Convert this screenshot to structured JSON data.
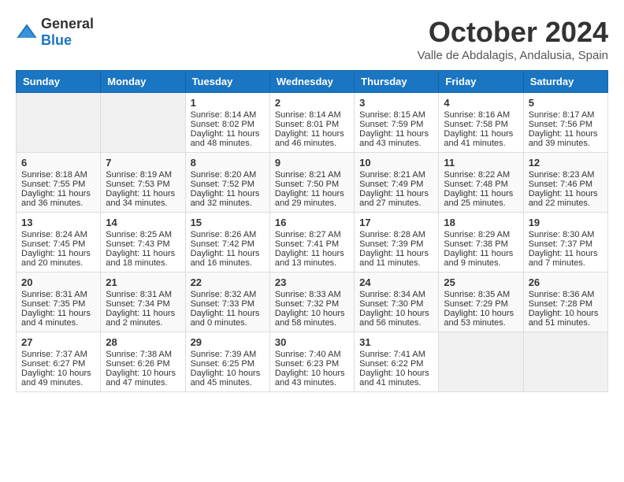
{
  "header": {
    "logo_general": "General",
    "logo_blue": "Blue",
    "month_title": "October 2024",
    "location": "Valle de Abdalagis, Andalusia, Spain"
  },
  "days_of_week": [
    "Sunday",
    "Monday",
    "Tuesday",
    "Wednesday",
    "Thursday",
    "Friday",
    "Saturday"
  ],
  "weeks": [
    [
      {
        "day": "",
        "empty": true
      },
      {
        "day": "",
        "empty": true
      },
      {
        "day": "1",
        "sunrise": "Sunrise: 8:14 AM",
        "sunset": "Sunset: 8:02 PM",
        "daylight": "Daylight: 11 hours and 48 minutes."
      },
      {
        "day": "2",
        "sunrise": "Sunrise: 8:14 AM",
        "sunset": "Sunset: 8:01 PM",
        "daylight": "Daylight: 11 hours and 46 minutes."
      },
      {
        "day": "3",
        "sunrise": "Sunrise: 8:15 AM",
        "sunset": "Sunset: 7:59 PM",
        "daylight": "Daylight: 11 hours and 43 minutes."
      },
      {
        "day": "4",
        "sunrise": "Sunrise: 8:16 AM",
        "sunset": "Sunset: 7:58 PM",
        "daylight": "Daylight: 11 hours and 41 minutes."
      },
      {
        "day": "5",
        "sunrise": "Sunrise: 8:17 AM",
        "sunset": "Sunset: 7:56 PM",
        "daylight": "Daylight: 11 hours and 39 minutes."
      }
    ],
    [
      {
        "day": "6",
        "sunrise": "Sunrise: 8:18 AM",
        "sunset": "Sunset: 7:55 PM",
        "daylight": "Daylight: 11 hours and 36 minutes."
      },
      {
        "day": "7",
        "sunrise": "Sunrise: 8:19 AM",
        "sunset": "Sunset: 7:53 PM",
        "daylight": "Daylight: 11 hours and 34 minutes."
      },
      {
        "day": "8",
        "sunrise": "Sunrise: 8:20 AM",
        "sunset": "Sunset: 7:52 PM",
        "daylight": "Daylight: 11 hours and 32 minutes."
      },
      {
        "day": "9",
        "sunrise": "Sunrise: 8:21 AM",
        "sunset": "Sunset: 7:50 PM",
        "daylight": "Daylight: 11 hours and 29 minutes."
      },
      {
        "day": "10",
        "sunrise": "Sunrise: 8:21 AM",
        "sunset": "Sunset: 7:49 PM",
        "daylight": "Daylight: 11 hours and 27 minutes."
      },
      {
        "day": "11",
        "sunrise": "Sunrise: 8:22 AM",
        "sunset": "Sunset: 7:48 PM",
        "daylight": "Daylight: 11 hours and 25 minutes."
      },
      {
        "day": "12",
        "sunrise": "Sunrise: 8:23 AM",
        "sunset": "Sunset: 7:46 PM",
        "daylight": "Daylight: 11 hours and 22 minutes."
      }
    ],
    [
      {
        "day": "13",
        "sunrise": "Sunrise: 8:24 AM",
        "sunset": "Sunset: 7:45 PM",
        "daylight": "Daylight: 11 hours and 20 minutes."
      },
      {
        "day": "14",
        "sunrise": "Sunrise: 8:25 AM",
        "sunset": "Sunset: 7:43 PM",
        "daylight": "Daylight: 11 hours and 18 minutes."
      },
      {
        "day": "15",
        "sunrise": "Sunrise: 8:26 AM",
        "sunset": "Sunset: 7:42 PM",
        "daylight": "Daylight: 11 hours and 16 minutes."
      },
      {
        "day": "16",
        "sunrise": "Sunrise: 8:27 AM",
        "sunset": "Sunset: 7:41 PM",
        "daylight": "Daylight: 11 hours and 13 minutes."
      },
      {
        "day": "17",
        "sunrise": "Sunrise: 8:28 AM",
        "sunset": "Sunset: 7:39 PM",
        "daylight": "Daylight: 11 hours and 11 minutes."
      },
      {
        "day": "18",
        "sunrise": "Sunrise: 8:29 AM",
        "sunset": "Sunset: 7:38 PM",
        "daylight": "Daylight: 11 hours and 9 minutes."
      },
      {
        "day": "19",
        "sunrise": "Sunrise: 8:30 AM",
        "sunset": "Sunset: 7:37 PM",
        "daylight": "Daylight: 11 hours and 7 minutes."
      }
    ],
    [
      {
        "day": "20",
        "sunrise": "Sunrise: 8:31 AM",
        "sunset": "Sunset: 7:35 PM",
        "daylight": "Daylight: 11 hours and 4 minutes."
      },
      {
        "day": "21",
        "sunrise": "Sunrise: 8:31 AM",
        "sunset": "Sunset: 7:34 PM",
        "daylight": "Daylight: 11 hours and 2 minutes."
      },
      {
        "day": "22",
        "sunrise": "Sunrise: 8:32 AM",
        "sunset": "Sunset: 7:33 PM",
        "daylight": "Daylight: 11 hours and 0 minutes."
      },
      {
        "day": "23",
        "sunrise": "Sunrise: 8:33 AM",
        "sunset": "Sunset: 7:32 PM",
        "daylight": "Daylight: 10 hours and 58 minutes."
      },
      {
        "day": "24",
        "sunrise": "Sunrise: 8:34 AM",
        "sunset": "Sunset: 7:30 PM",
        "daylight": "Daylight: 10 hours and 56 minutes."
      },
      {
        "day": "25",
        "sunrise": "Sunrise: 8:35 AM",
        "sunset": "Sunset: 7:29 PM",
        "daylight": "Daylight: 10 hours and 53 minutes."
      },
      {
        "day": "26",
        "sunrise": "Sunrise: 8:36 AM",
        "sunset": "Sunset: 7:28 PM",
        "daylight": "Daylight: 10 hours and 51 minutes."
      }
    ],
    [
      {
        "day": "27",
        "sunrise": "Sunrise: 7:37 AM",
        "sunset": "Sunset: 6:27 PM",
        "daylight": "Daylight: 10 hours and 49 minutes."
      },
      {
        "day": "28",
        "sunrise": "Sunrise: 7:38 AM",
        "sunset": "Sunset: 6:26 PM",
        "daylight": "Daylight: 10 hours and 47 minutes."
      },
      {
        "day": "29",
        "sunrise": "Sunrise: 7:39 AM",
        "sunset": "Sunset: 6:25 PM",
        "daylight": "Daylight: 10 hours and 45 minutes."
      },
      {
        "day": "30",
        "sunrise": "Sunrise: 7:40 AM",
        "sunset": "Sunset: 6:23 PM",
        "daylight": "Daylight: 10 hours and 43 minutes."
      },
      {
        "day": "31",
        "sunrise": "Sunrise: 7:41 AM",
        "sunset": "Sunset: 6:22 PM",
        "daylight": "Daylight: 10 hours and 41 minutes."
      },
      {
        "day": "",
        "empty": true
      },
      {
        "day": "",
        "empty": true
      }
    ]
  ]
}
